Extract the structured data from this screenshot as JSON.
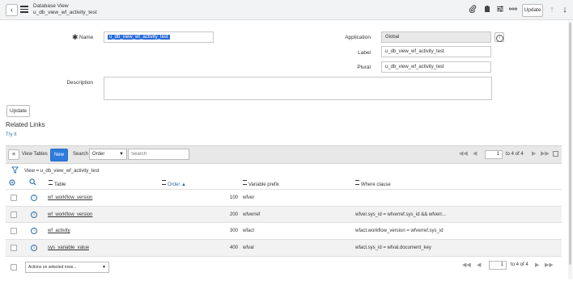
{
  "header": {
    "title": "Database View",
    "subtitle": "u_db_view_wf_activity_test",
    "update_label": "Update"
  },
  "form": {
    "name_label": "Name",
    "name_value": "u_db_view_wf_activity_test",
    "application_label": "Application",
    "application_value": "Global",
    "label_label": "Label",
    "label_value": "u_db_view_wf_activity_test",
    "plural_label": "Plural",
    "plural_value": "u_db_view_wf_activity_test",
    "description_label": "Description",
    "description_value": "",
    "update_label": "Update"
  },
  "related": {
    "title": "Related Links",
    "try_it": "Try It"
  },
  "list": {
    "view_tables_label": "View Tables",
    "new_label": "New",
    "search_label": "Search",
    "search_field": "Order",
    "search_placeholder": "Search",
    "page_value": "1",
    "page_total": "to 4 of 4",
    "filter_text": "View = u_db_view_wf_activity_test",
    "columns": [
      "Table",
      "Order",
      "Variable prefix",
      "Where clause"
    ],
    "rows": [
      {
        "table": "wf_workflow_version",
        "order": "100",
        "prefix": "wfver",
        "where": ""
      },
      {
        "table": "wf_workflow_version",
        "order": "200",
        "prefix": "wfverref",
        "where": "wfver.sys_id = wfverref.sys_id && wfverr..."
      },
      {
        "table": "wf_activity",
        "order": "300",
        "prefix": "wfact",
        "where": "wfact.workflow_version = wfverref.sys_id"
      },
      {
        "table": "sys_variable_value",
        "order": "400",
        "prefix": "wfval",
        "where": "wfact.sys_id = wfval.document_key"
      }
    ],
    "actions_label": "Actions on selected rows..."
  }
}
